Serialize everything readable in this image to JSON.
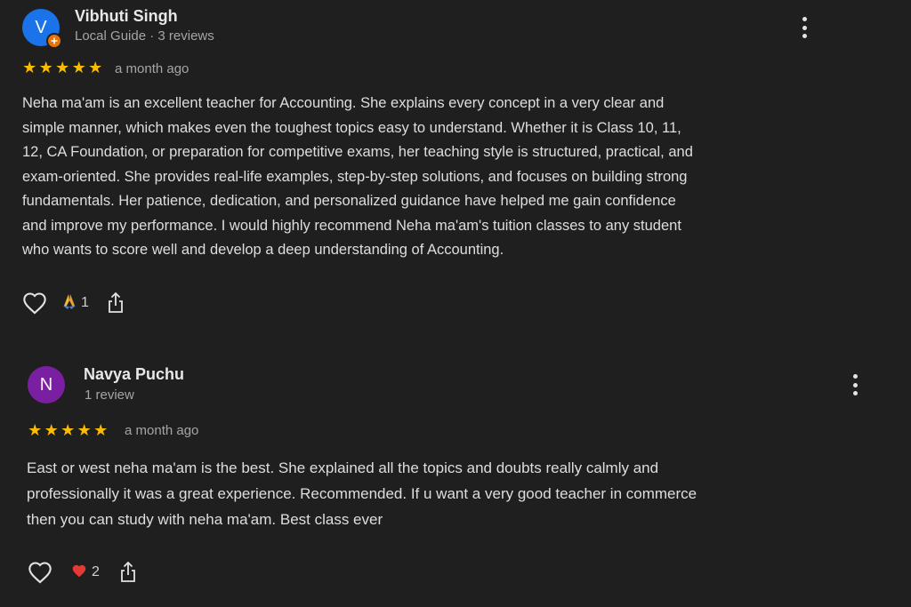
{
  "reviews": [
    {
      "author": "Vibhuti Singh",
      "avatar_letter": "V",
      "avatar_color": "#1a73e8",
      "meta": "Local Guide · 3 reviews",
      "rating": 5,
      "date": "a month ago",
      "lines": [
        "Neha ma'am is an excellent teacher for Accounting. She explains every concept in a very clear and",
        "simple manner, which makes even the toughest topics easy to understand. Whether it is Class 10, 11,",
        "12, CA Foundation, or preparation for competitive exams, her teaching style is structured, practical, and",
        "exam-oriented. She provides real-life examples, step-by-step solutions, and focuses on building strong",
        "fundamentals. Her patience, dedication, and personalized guidance have helped me gain confidence",
        "and improve my performance. I would highly recommend Neha ma'am's tuition classes to any student",
        "who wants to score well and develop a deep understanding of Accounting."
      ],
      "reaction_icon": "folded-hands-emoji",
      "reaction_count": "1"
    },
    {
      "author": "Navya Puchu",
      "avatar_letter": "N",
      "avatar_color": "#7b1fa2",
      "meta": "1 review",
      "rating": 5,
      "date": "a month ago",
      "lines": [
        "East or west neha ma'am is the best. She explained all the topics and doubts really calmly and",
        "professionally it was a great experience. Recommended. If u want a very good teacher in commerce",
        "then you can study with neha ma'am. Best class ever"
      ],
      "reaction_icon": "red-heart-emoji",
      "reaction_count": "2"
    }
  ],
  "colors": {
    "background": "#1f1f1f",
    "star": "#fbbc04",
    "local_guide_badge": "#e8710a"
  }
}
